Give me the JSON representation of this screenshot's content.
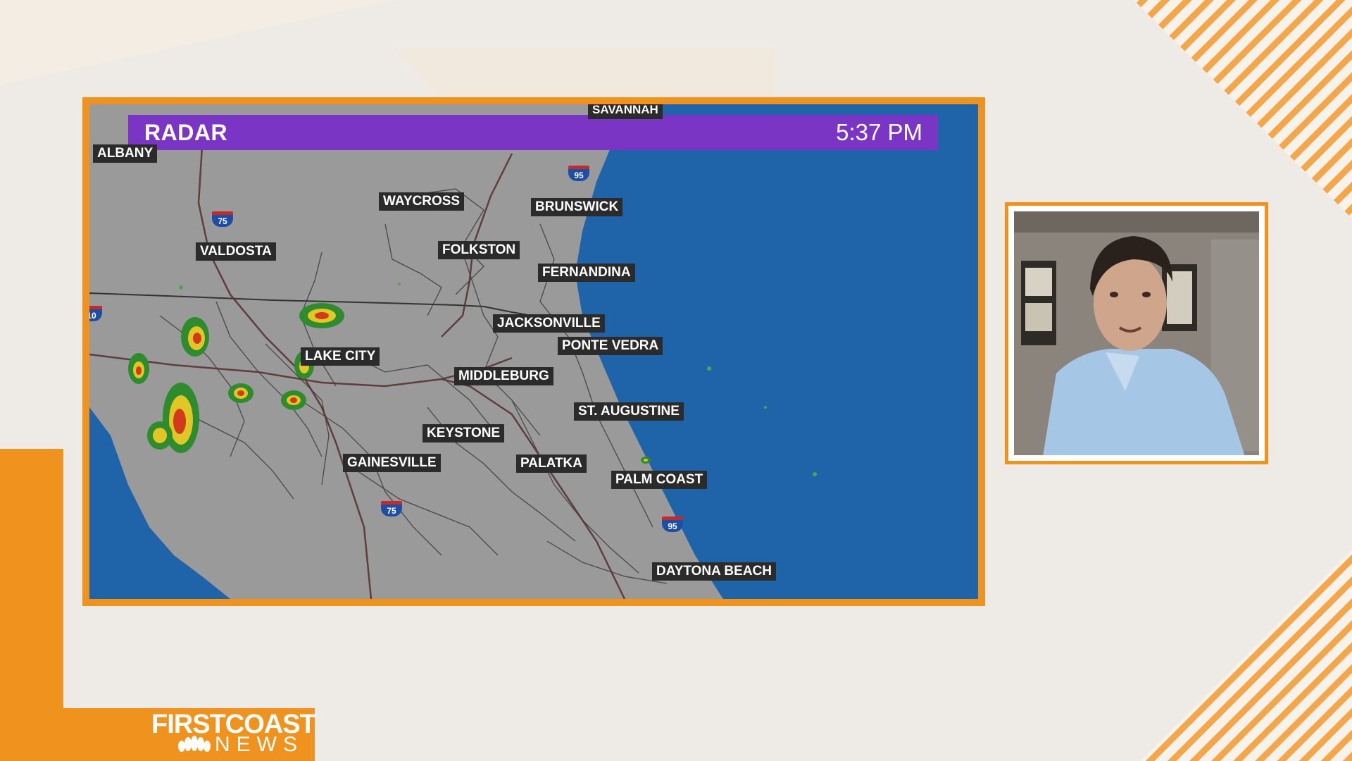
{
  "radar": {
    "title": "RADAR",
    "time": "5:37 PM"
  },
  "cities": {
    "savannah": "SAVANNAH",
    "albany": "ALBANY",
    "waycross": "WAYCROSS",
    "brunswick": "BRUNSWICK",
    "valdosta": "VALDOSTA",
    "folkston": "FOLKSTON",
    "fernandina": "FERNANDINA",
    "jacksonville": "JACKSONVILLE",
    "ponte_vedra": "PONTE VEDRA",
    "lake_city": "LAKE CITY",
    "middleburg": "MIDDLEBURG",
    "st_augustine": "ST. AUGUSTINE",
    "keystone": "KEYSTONE",
    "gainesville": "GAINESVILLE",
    "palatka": "PALATKA",
    "palm_coast": "PALM COAST",
    "daytona_beach": "DAYTONA BEACH"
  },
  "interstates": {
    "i95_north": "95",
    "i75_north": "75",
    "i75_south": "75",
    "i95_south": "95",
    "i10_west": "10"
  },
  "logo": {
    "line1": "FIRSTCOAST",
    "line2": "NEWS"
  },
  "colors": {
    "accent": "#f0921e",
    "title_bar": "#7a35c4",
    "ocean": "#1f63a8",
    "land": "#9a9a9a"
  }
}
